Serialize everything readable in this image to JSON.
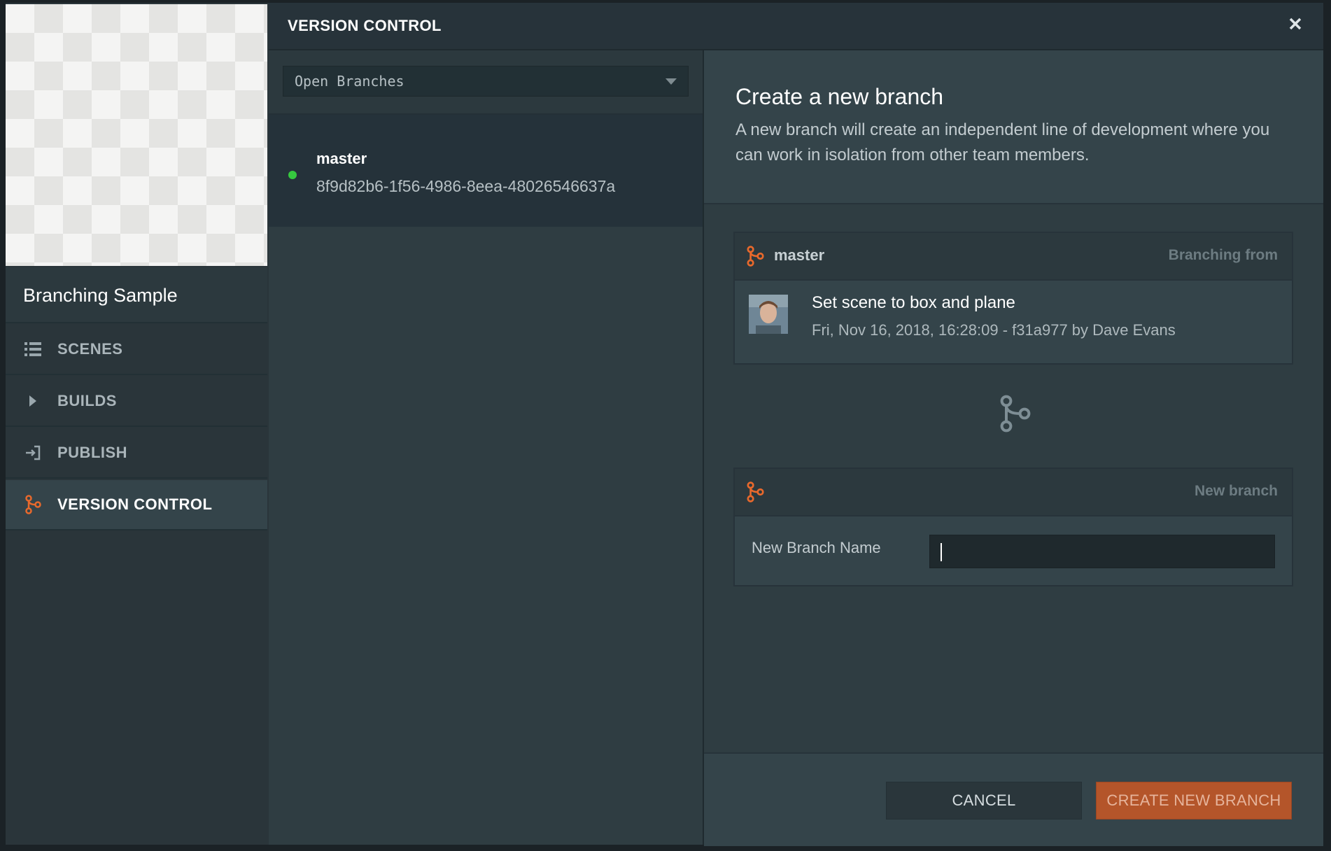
{
  "sidebar": {
    "project_name": "Branching Sample",
    "items": [
      {
        "label": "SCENES",
        "icon": "list-icon"
      },
      {
        "label": "BUILDS",
        "icon": "play-icon"
      },
      {
        "label": "PUBLISH",
        "icon": "publish-icon"
      },
      {
        "label": "VERSION CONTROL",
        "icon": "branch-icon",
        "active": true
      }
    ]
  },
  "dialog": {
    "title": "VERSION CONTROL",
    "close_icon": "close-icon"
  },
  "branches": {
    "filter_selected": "Open Branches",
    "list": [
      {
        "name": "master",
        "id": "8f9d82b6-1f56-4986-8eea-48026546637a",
        "status_color": "#36c93f"
      }
    ]
  },
  "create": {
    "title": "Create a new branch",
    "description": "A new branch will create an independent line of development where you can work in isolation from other team members.",
    "source": {
      "branch_name": "master",
      "right_label": "Branching from",
      "commit_message": "Set scene to box and plane",
      "commit_meta": "Fri, Nov 16, 2018, 16:28:09 - f31a977 by Dave Evans"
    },
    "new_branch": {
      "right_label": "New branch",
      "field_label": "New Branch Name",
      "value": ""
    },
    "buttons": {
      "cancel": "CANCEL",
      "create": "CREATE NEW BRANCH"
    }
  },
  "colors": {
    "accent": "#e8692c",
    "create_button": "#b4552a",
    "status_green": "#36c93f"
  }
}
